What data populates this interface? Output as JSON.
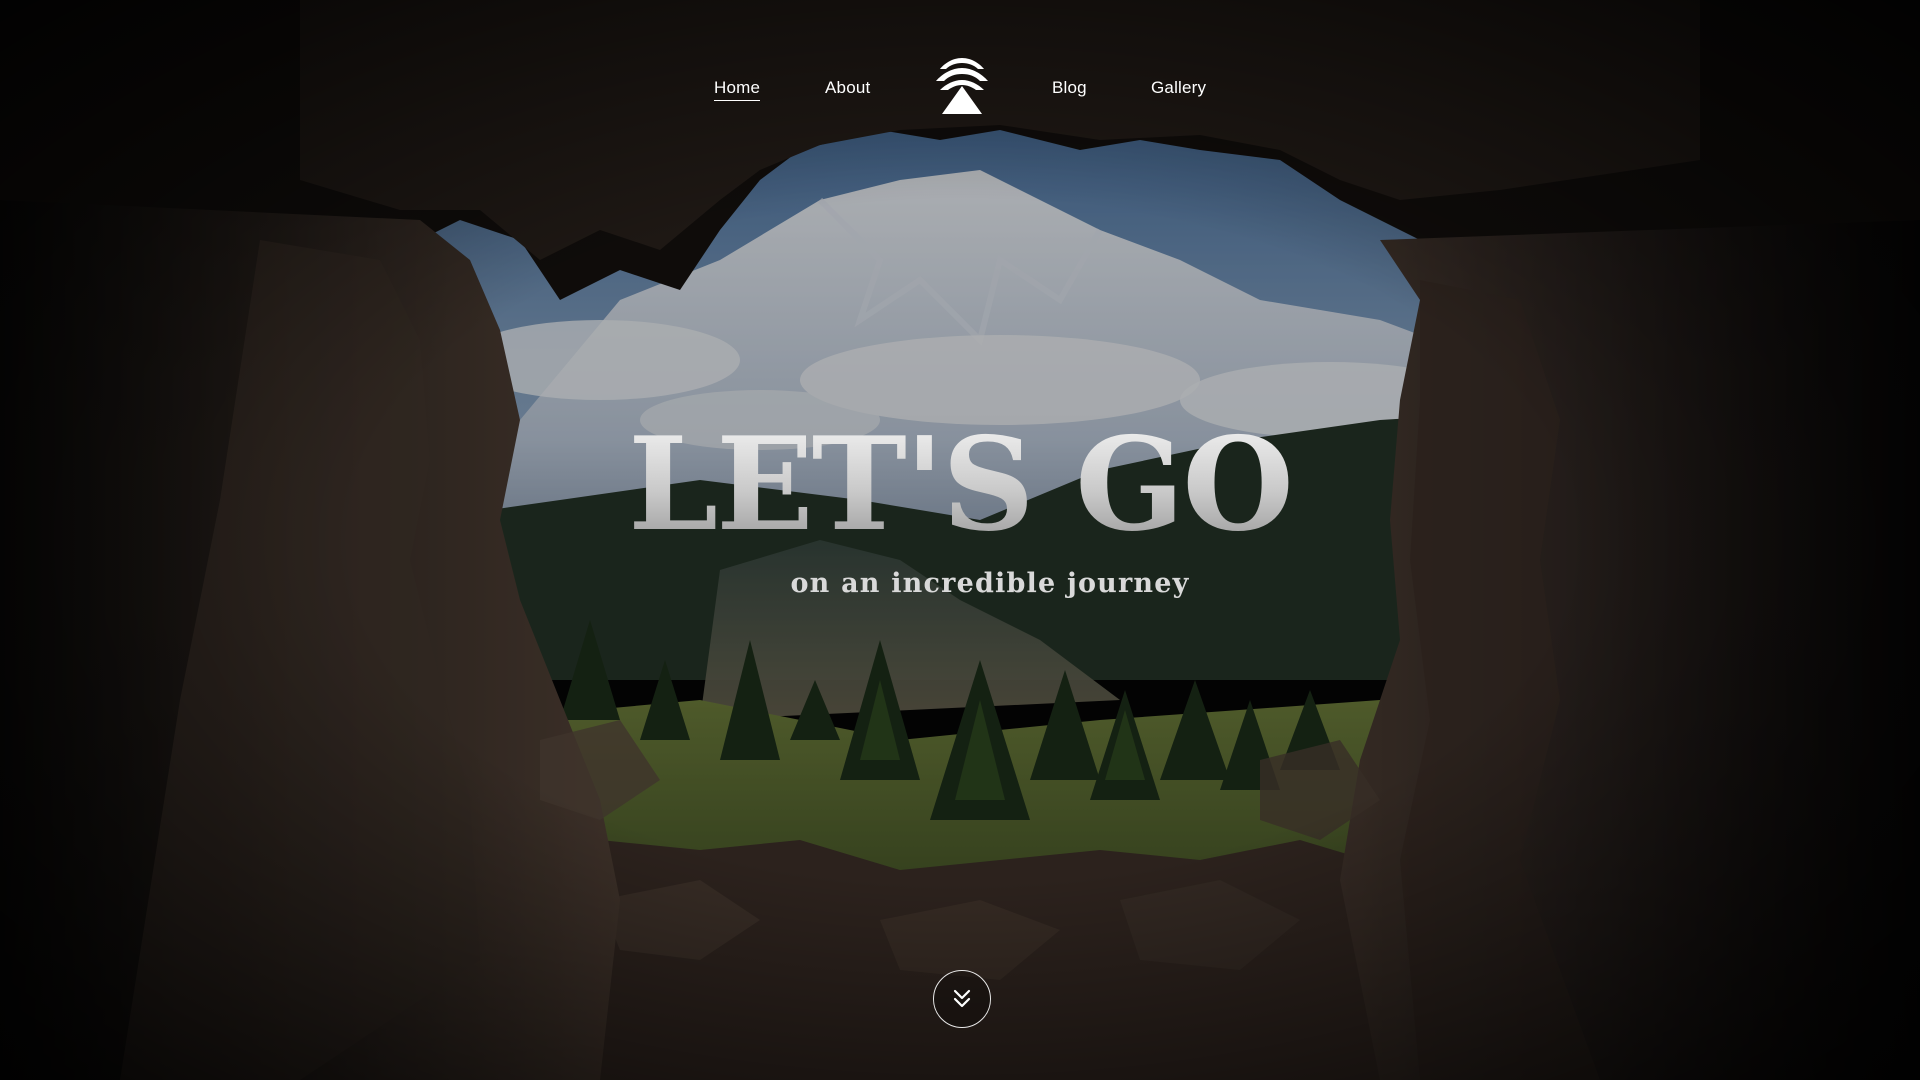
{
  "nav": {
    "items": [
      {
        "label": "Home",
        "active": true
      },
      {
        "label": "About",
        "active": false
      },
      {
        "label": "Blog",
        "active": false
      },
      {
        "label": "Gallery",
        "active": false
      }
    ],
    "logo_icon": "pine-tree-icon"
  },
  "hero": {
    "title": "LET'S GO",
    "subtitle": "on an incredible journey"
  },
  "scroll_button": {
    "icon": "double-chevron-down-icon"
  },
  "colors": {
    "text": "#ffffff",
    "background": "#050505",
    "sky": "#6f8fb3",
    "snow": "#e9eef5",
    "forest": "#3e5a2a",
    "rock": "#3a2f28"
  }
}
